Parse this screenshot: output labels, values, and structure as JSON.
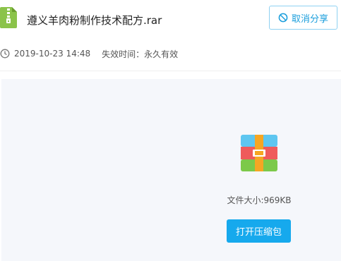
{
  "file": {
    "name": "遵义羊肉粉制作技术配方.rar",
    "icon": "compressed-file-icon"
  },
  "share": {
    "cancel_label": "取消分享",
    "cancel_icon": "ban-icon"
  },
  "meta": {
    "date": "2019-10-23 14:48",
    "expiry": "失效时间：永久有效",
    "clock_icon": "clock-icon"
  },
  "preview": {
    "icon": "archive-icon",
    "size_text": "文件大小:969KB",
    "open_label": "打开压缩包"
  },
  "colors": {
    "accent": "#16a9ed",
    "file_icon_green": "#8bc34a"
  }
}
